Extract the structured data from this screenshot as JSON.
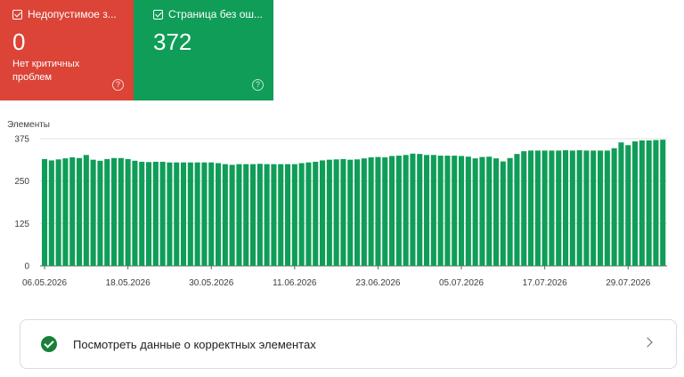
{
  "cards": {
    "error": {
      "title": "Недопустимое з...",
      "value": "0",
      "subtitle": "Нет критичных проблем",
      "checked": true,
      "color": "#db4437",
      "help_icon": "help-circle-icon"
    },
    "valid": {
      "title": "Страница без ош...",
      "value": "372",
      "checked": true,
      "color": "#0f9d58",
      "help_icon": "help-circle-icon"
    }
  },
  "chart_data": {
    "type": "bar",
    "ylabel": "Элементы",
    "ylim": [
      0,
      375
    ],
    "yticks": [
      "0",
      "125",
      "250",
      "375"
    ],
    "xtick_labels": [
      "06.05.2026",
      "18.05.2026",
      "30.05.2026",
      "11.06.2026",
      "23.06.2026",
      "05.07.2026",
      "17.07.2026",
      "29.07.2026"
    ],
    "bar_color": "#0f9d58",
    "grid": true,
    "values": [
      315,
      311,
      314,
      317,
      320,
      318,
      327,
      313,
      310,
      315,
      318,
      318,
      315,
      310,
      307,
      306,
      307,
      307,
      305,
      305,
      305,
      305,
      305,
      305,
      305,
      303,
      300,
      298,
      300,
      300,
      300,
      301,
      300,
      300,
      300,
      300,
      300,
      303,
      305,
      307,
      311,
      313,
      314,
      315,
      313,
      314,
      317,
      320,
      321,
      320,
      324,
      325,
      327,
      331,
      330,
      327,
      327,
      325,
      325,
      325,
      324,
      322,
      317,
      321,
      322,
      317,
      308,
      318,
      330,
      338,
      340,
      340,
      340,
      340,
      340,
      341,
      340,
      341,
      340,
      340,
      340,
      340,
      347,
      364,
      356,
      367,
      370,
      370,
      371,
      372
    ]
  },
  "valid_row": {
    "label": "Посмотреть данные о корректных элементах",
    "icon": "check-circle-icon",
    "arrow_icon": "chevron-right-icon"
  }
}
